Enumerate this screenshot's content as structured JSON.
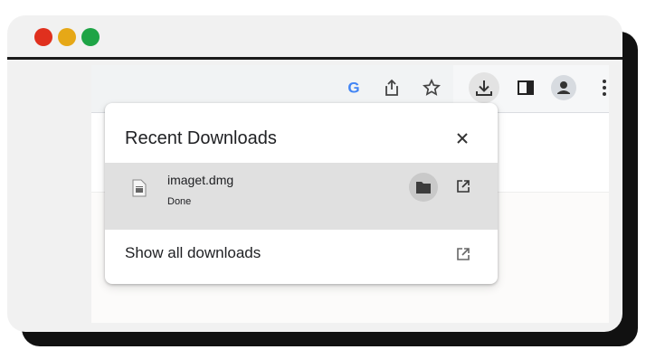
{
  "window": {
    "controls": [
      "close-dot",
      "minimize-dot",
      "maximize-dot"
    ],
    "colors": {
      "close": "#e0301e",
      "minimize": "#e6a817",
      "maximize": "#1ea446"
    }
  },
  "toolbar": {
    "icons": [
      "google-icon",
      "share-icon",
      "bookmark-star-icon",
      "download-icon",
      "side-panel-icon",
      "profile-avatar-icon",
      "more-menu-icon"
    ],
    "google_letter": "G"
  },
  "downloads_popup": {
    "title": "Recent Downloads",
    "items": [
      {
        "filename": "imaget.dmg",
        "status": "Done",
        "icon": "file-icon"
      }
    ],
    "show_all_label": "Show all downloads"
  }
}
